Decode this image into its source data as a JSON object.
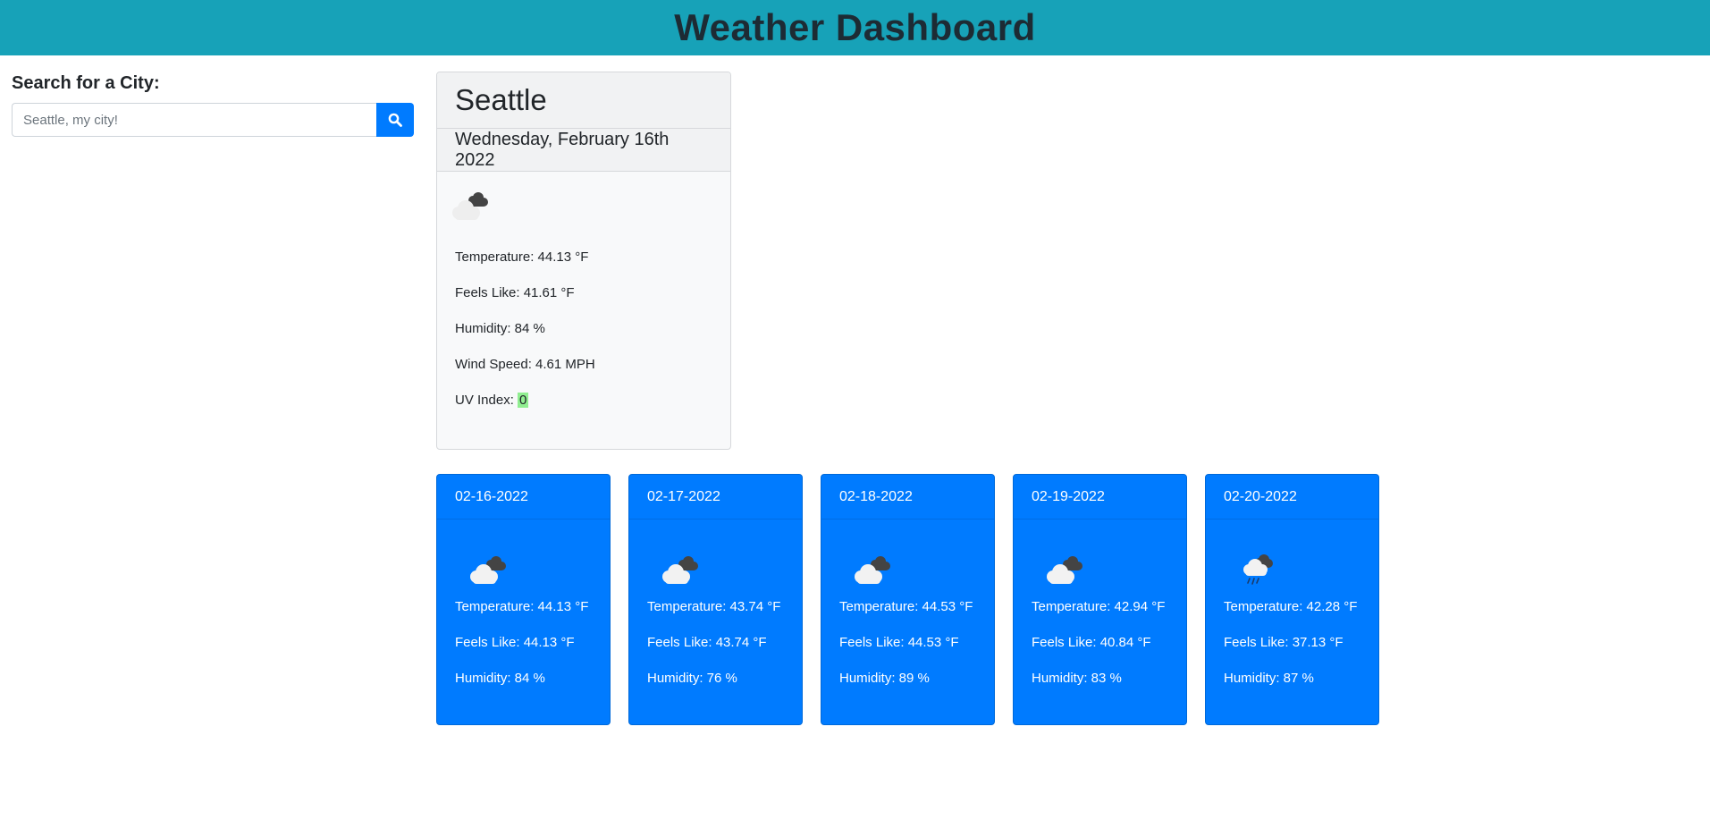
{
  "header": {
    "title": "Weather Dashboard"
  },
  "search": {
    "label": "Search for a City:",
    "placeholder": "Seattle, my city!",
    "button_icon": "search-icon"
  },
  "current": {
    "city": "Seattle",
    "date": "Wednesday, February 16th 2022",
    "icon": "broken-clouds-icon",
    "temperature": "Temperature: 44.13 °F",
    "feels_like": "Feels Like: 41.61 °F",
    "humidity": "Humidity: 84 %",
    "wind_speed": "Wind Speed: 4.61 MPH",
    "uv_label": "UV Index: ",
    "uv_value": "0",
    "uv_color": "#90ee90"
  },
  "forecast": [
    {
      "date": "02-16-2022",
      "icon": "broken-clouds-icon",
      "temperature": "Temperature: 44.13 °F",
      "feels_like": "Feels Like: 44.13 °F",
      "humidity": "Humidity: 84 %"
    },
    {
      "date": "02-17-2022",
      "icon": "broken-clouds-icon",
      "temperature": "Temperature: 43.74 °F",
      "feels_like": "Feels Like: 43.74 °F",
      "humidity": "Humidity: 76 %"
    },
    {
      "date": "02-18-2022",
      "icon": "broken-clouds-icon",
      "temperature": "Temperature: 44.53 °F",
      "feels_like": "Feels Like: 44.53 °F",
      "humidity": "Humidity: 89 %"
    },
    {
      "date": "02-19-2022",
      "icon": "broken-clouds-icon",
      "temperature": "Temperature: 42.94 °F",
      "feels_like": "Feels Like: 40.84 °F",
      "humidity": "Humidity: 83 %"
    },
    {
      "date": "02-20-2022",
      "icon": "rain-cloud-icon",
      "temperature": "Temperature: 42.28 °F",
      "feels_like": "Feels Like: 37.13 °F",
      "humidity": "Humidity: 87 %"
    }
  ],
  "colors": {
    "header": "#17a2b8",
    "accent": "#007bff"
  }
}
